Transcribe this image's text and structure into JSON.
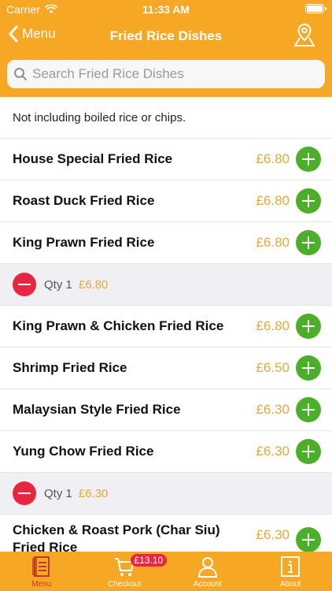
{
  "status_bar": {
    "carrier": "Carrier",
    "time": "11:33 AM"
  },
  "nav": {
    "back_label": "Menu",
    "title": "Fried Rice Dishes"
  },
  "search": {
    "placeholder": "Search Fried Rice Dishes"
  },
  "note": "Not including boiled rice or chips.",
  "items": [
    {
      "name": "House Special Fried Rice",
      "price": "£6.80"
    },
    {
      "name": "Roast Duck Fried Rice",
      "price": "£6.80"
    },
    {
      "name": "King Prawn Fried Rice",
      "price": "£6.80"
    },
    {
      "name": "King Prawn & Chicken Fried Rice",
      "price": "£6.80"
    },
    {
      "name": "Shrimp Fried Rice",
      "price": "£6.50"
    },
    {
      "name": "Malaysian Style Fried Rice",
      "price": "£6.30"
    },
    {
      "name": "Yung Chow Fried Rice",
      "price": "£6.30"
    },
    {
      "name": "Chicken & Roast Pork (Char Siu) Fried Rice",
      "price": "£6.30"
    }
  ],
  "qty_rows": [
    {
      "label": "Qty 1",
      "price": "£6.80"
    },
    {
      "label": "Qty 1",
      "price": "£6.30"
    }
  ],
  "tabbar": {
    "tabs": [
      {
        "label": "Menu",
        "icon": "menu-book-icon",
        "active": true
      },
      {
        "label": "Checkout",
        "icon": "cart-icon",
        "badge": "£13.10"
      },
      {
        "label": "Account",
        "icon": "person-icon"
      },
      {
        "label": "About",
        "icon": "info-icon"
      }
    ]
  },
  "colors": {
    "brand": "#f6a723",
    "add": "#4caf2a",
    "remove": "#e8263f",
    "price": "#e4a93a",
    "active_tab": "#c0392b"
  }
}
